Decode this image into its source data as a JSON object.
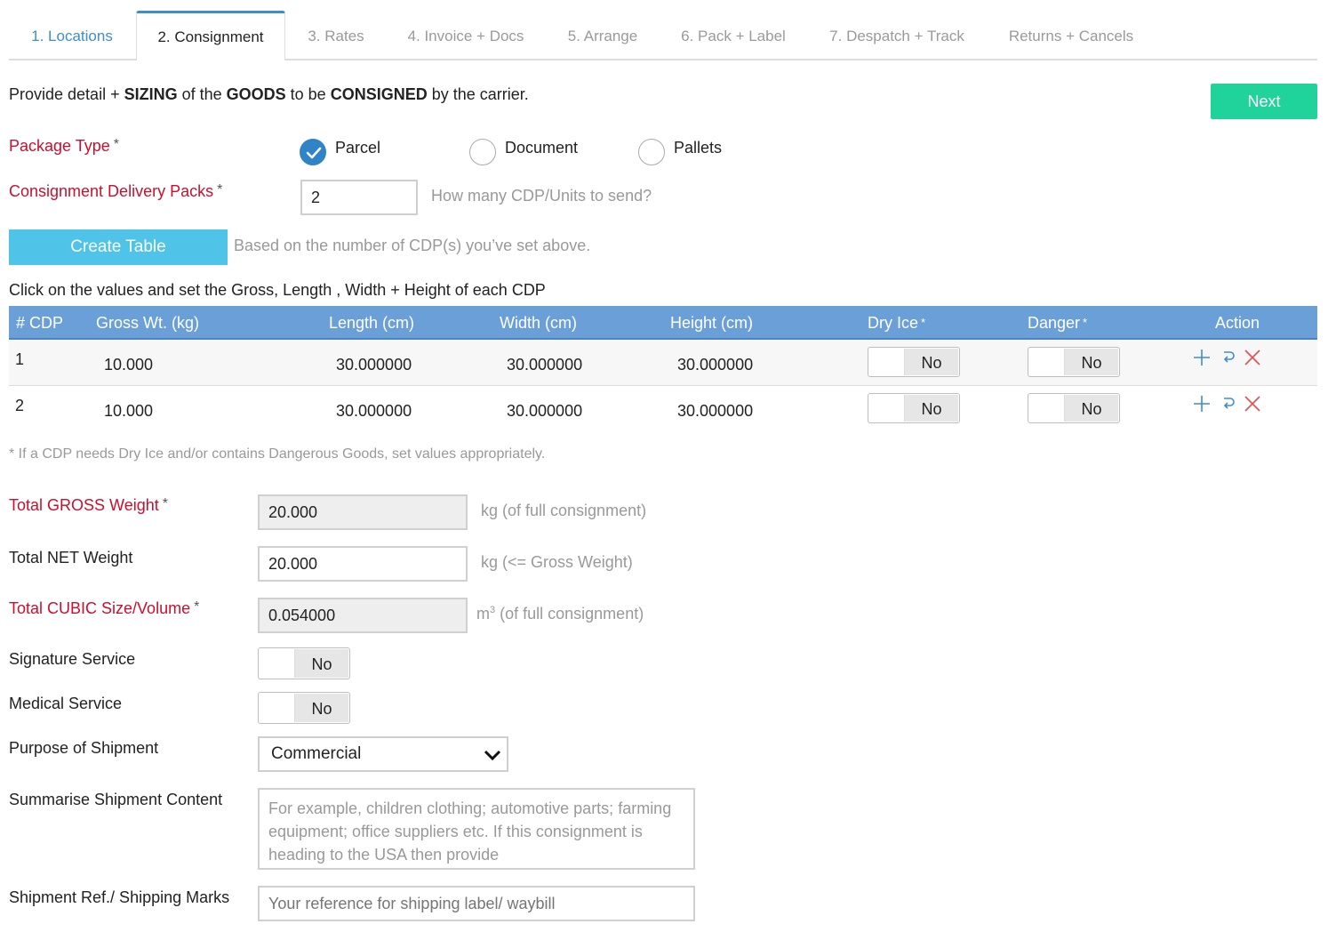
{
  "tabs": [
    {
      "label": "1. Locations"
    },
    {
      "label": "2. Consignment"
    },
    {
      "label": "3. Rates"
    },
    {
      "label": "4. Invoice + Docs"
    },
    {
      "label": "5. Arrange"
    },
    {
      "label": "6. Pack + Label"
    },
    {
      "label": "7. Despatch + Track"
    },
    {
      "label": "Returns + Cancels"
    }
  ],
  "intro": {
    "p1": "Provide detail + ",
    "b1": "SIZING",
    "p2": " of the ",
    "b2": "GOODS",
    "p3": " to be ",
    "b3": "CONSIGNED",
    "p4": " by the carrier."
  },
  "next_label": "Next",
  "package_type": {
    "label": "Package Type",
    "options": [
      "Parcel",
      "Document",
      "Pallets"
    ],
    "selected": "Parcel"
  },
  "cdp": {
    "label": "Consignment Delivery Packs",
    "value": "2",
    "hint": "How many CDP/Units to send?"
  },
  "create_table": {
    "label": "Create Table",
    "hint": "Based on the number of CDP(s) you’ve set above."
  },
  "table_instruction": "Click on the values and set the Gross, Length , Width + Height of each CDP",
  "table": {
    "headers": [
      "# CDP",
      "Gross Wt. (kg)",
      "Length (cm)",
      "Width (cm)",
      "Height (cm)",
      "Dry Ice",
      "Danger",
      "Action"
    ],
    "rows": [
      {
        "cdp": "1",
        "gross": "10.000",
        "length": "30.000000",
        "width": "30.000000",
        "height": "30.000000",
        "dry_ice": "No",
        "danger": "No"
      },
      {
        "cdp": "2",
        "gross": "10.000",
        "length": "30.000000",
        "width": "30.000000",
        "height": "30.000000",
        "dry_ice": "No",
        "danger": "No"
      }
    ]
  },
  "table_note": "* If a CDP needs Dry Ice and/or contains Dangerous Goods, set values appropriately.",
  "total_gross": {
    "label": "Total GROSS Weight",
    "value": "20.000",
    "hint": "kg (of full consignment)"
  },
  "total_net": {
    "label": "Total NET Weight",
    "value": "20.000",
    "hint": "kg (<= Gross Weight)"
  },
  "total_cubic": {
    "label": "Total CUBIC Size/Volume",
    "value": "0.054000",
    "hint_unit": "m",
    "hint_sup": "3",
    "hint_rest": " (of full consignment)"
  },
  "signature": {
    "label": "Signature Service",
    "value": "No"
  },
  "medical": {
    "label": "Medical Service",
    "value": "No"
  },
  "purpose": {
    "label": "Purpose of Shipment",
    "value": "Commercial"
  },
  "summary": {
    "label": "Summarise Shipment Content",
    "placeholder": "For example, children clothing; automotive parts; farming equipment; office suppliers etc.  If this consignment is heading to the USA then provide"
  },
  "shipment_ref": {
    "label": "Shipment Ref./ Shipping Marks",
    "placeholder": "Your reference for shipping label/ waybill"
  },
  "required_mark": "*",
  "colors": {
    "accent": "#3d8ec9",
    "next": "#20d39a",
    "create": "#4fc3e8",
    "header": "#6a9fd8",
    "required": "#c8102e",
    "delete": "#e05050"
  }
}
